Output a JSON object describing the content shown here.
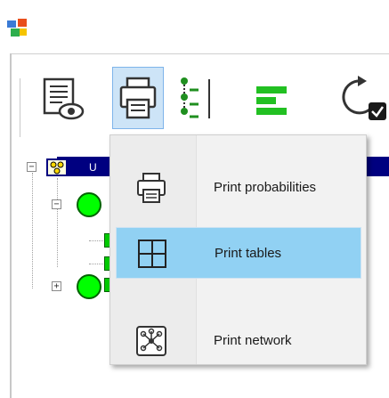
{
  "app": {
    "icon": "app-logo-icon"
  },
  "toolbar": {
    "buttons": [
      {
        "id": "view",
        "icon": "document-view-icon"
      },
      {
        "id": "print",
        "icon": "printer-icon",
        "active": true
      },
      {
        "id": "tree",
        "icon": "tree-structure-icon"
      },
      {
        "id": "bars",
        "icon": "bar-chart-icon"
      },
      {
        "id": "update",
        "icon": "refresh-check-icon"
      }
    ]
  },
  "tree": {
    "header_label": "U",
    "colors": {
      "header": "#000080",
      "node": "#00ff00",
      "selection": "#91d1f3"
    }
  },
  "menu": {
    "items": [
      {
        "label": "Print probabilities",
        "icon": "printer-icon"
      },
      {
        "label": "Print tables",
        "icon": "table-grid-icon",
        "selected": true
      },
      {
        "label": "Print network",
        "icon": "network-icon"
      }
    ]
  }
}
